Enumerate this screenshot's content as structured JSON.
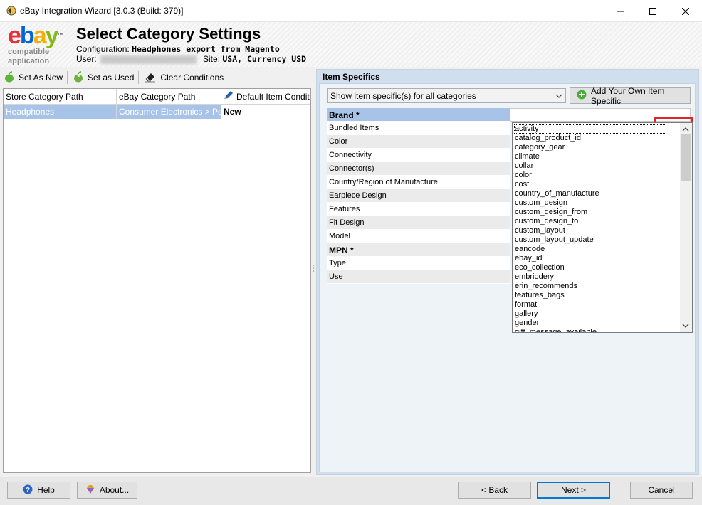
{
  "window": {
    "title": "eBay Integration Wizard [3.0.3 (Build: 379)]"
  },
  "header": {
    "logo_caption_line1": "compatible",
    "logo_caption_line2": "application",
    "heading": "Select Category Settings",
    "config_label": "Configuration:",
    "config_value": "Headphones export from Magento",
    "user_label": "User:",
    "site_label": "Site:",
    "site_value": "USA, Currency USD"
  },
  "left_toolbar": {
    "set_as_new": "Set As New",
    "set_as_used": "Set as Used",
    "clear_conditions": "Clear Conditions"
  },
  "left_grid": {
    "columns": [
      "Store Category Path",
      "eBay Category Path",
      "Default Item Condition"
    ],
    "rows": [
      [
        "Headphones",
        "Consumer Electronics > Portable",
        "New"
      ]
    ]
  },
  "item_specifics": {
    "title": "Item Specifics",
    "filter_value": "Show item specific(s) for all categories",
    "add_button": "Add Your Own Item Specific",
    "specifics": [
      "Brand *",
      "Bundled Items",
      "Color",
      "Connectivity",
      "Connector(s)",
      "Country/Region of Manufacture",
      "Earpiece Design",
      "Features",
      "Fit Design",
      "Model",
      "MPN *",
      "Type",
      "Use"
    ],
    "brand_value": "",
    "dropdown_options": [
      "activity",
      "catalog_product_id",
      "category_gear",
      "climate",
      "collar",
      "color",
      "cost",
      "country_of_manufacture",
      "custom_design",
      "custom_design_from",
      "custom_design_to",
      "custom_layout",
      "custom_layout_update",
      "eancode",
      "ebay_id",
      "eco_collection",
      "embriodery",
      "erin_recommends",
      "features_bags",
      "format",
      "gallery",
      "gender",
      "gift_message_available"
    ]
  },
  "footer": {
    "help": "Help",
    "about": "About...",
    "back": "< Back",
    "next": "Next >",
    "cancel": "Cancel"
  },
  "colors": {
    "selection": "#a7c3e8",
    "panel_bg": "#cfdfee",
    "highlight_box": "#e2252b",
    "accent": "#0078d7"
  }
}
